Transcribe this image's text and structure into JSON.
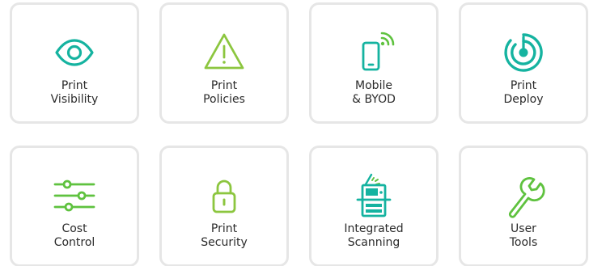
{
  "tiles": [
    {
      "line1": "Print",
      "line2": "Visibility",
      "icon": "eye-icon"
    },
    {
      "line1": "Print",
      "line2": "Policies",
      "icon": "warning-triangle-icon"
    },
    {
      "line1": "Mobile",
      "line2": "& BYOD",
      "icon": "mobile-phone-icon"
    },
    {
      "line1": "Print",
      "line2": "Deploy",
      "icon": "radar-icon"
    },
    {
      "line1": "Cost",
      "line2": "Control",
      "icon": "sliders-icon"
    },
    {
      "line1": "Print",
      "line2": "Security",
      "icon": "padlock-icon"
    },
    {
      "line1": "Integrated",
      "line2": "Scanning",
      "icon": "multifunction-printer-icon"
    },
    {
      "line1": "User",
      "line2": "Tools",
      "icon": "wrench-icon"
    }
  ],
  "colors": {
    "teal": "#15b3a0",
    "green": "#5fc23f",
    "lime": "#8cc63f",
    "card_border": "#e6e6e6",
    "label_text": "#2b2b2b"
  }
}
